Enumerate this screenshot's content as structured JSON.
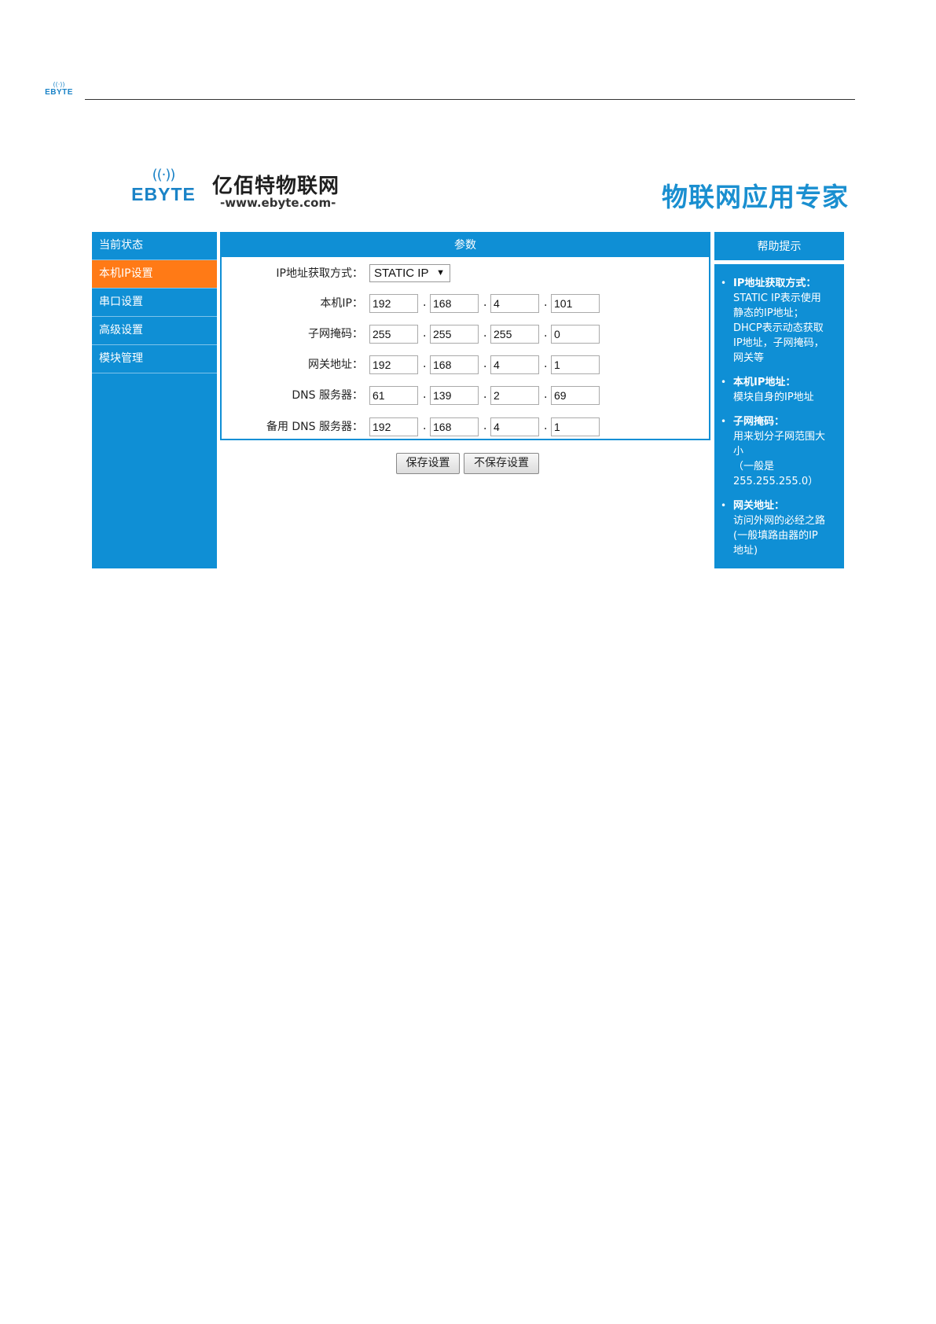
{
  "doc_header": {
    "logo_text": "EBYTE"
  },
  "banner": {
    "logo_text": "EBYTE",
    "brand_cn": "亿佰特物联网",
    "url": "-www.ebyte.com-",
    "slogan": "物联网应用专家"
  },
  "nav": {
    "items": [
      {
        "label": "当前状态",
        "active": false
      },
      {
        "label": "本机IP设置",
        "active": true
      },
      {
        "label": "串口设置",
        "active": false
      },
      {
        "label": "高级设置",
        "active": false
      },
      {
        "label": "模块管理",
        "active": false
      }
    ]
  },
  "panel": {
    "title": "参数",
    "mode": {
      "label": "IP地址获取方式：",
      "value": "STATIC IP"
    },
    "fields": [
      {
        "label": "本机IP：",
        "octets": [
          "192",
          "168",
          "4",
          "101"
        ]
      },
      {
        "label": "子网掩码：",
        "octets": [
          "255",
          "255",
          "255",
          "0"
        ]
      },
      {
        "label": "网关地址：",
        "octets": [
          "192",
          "168",
          "4",
          "1"
        ]
      },
      {
        "label": "DNS 服务器：",
        "octets": [
          "61",
          "139",
          "2",
          "69"
        ]
      },
      {
        "label": "备用 DNS 服务器：",
        "octets": [
          "192",
          "168",
          "4",
          "1"
        ]
      }
    ],
    "dot": "."
  },
  "buttons": {
    "save": "保存设置",
    "nosave": "不保存设置"
  },
  "help": {
    "title": "帮助提示",
    "bullet": "•",
    "items": [
      {
        "title": "IP地址获取方式：",
        "lines": [
          "STATIC IP表示使用",
          "静态的IP地址；",
          "DHCP表示动态获取",
          "IP地址，子网掩码，",
          "网关等"
        ]
      },
      {
        "title": "本机IP地址：",
        "lines": [
          "模块自身的IP地址"
        ]
      },
      {
        "title": "子网掩码：",
        "lines": [
          "用来划分子网范围大",
          "小",
          "（一般是",
          "255.255.255.0）"
        ]
      },
      {
        "title": "网关地址：",
        "lines": [
          "访问外网的必经之路",
          "(一般填路由器的IP",
          "地址)"
        ]
      }
    ]
  },
  "colors": {
    "primary": "#0f8fd5",
    "active": "#ff7a16"
  },
  "icons": {
    "logo": "wifi-signal-icon"
  }
}
